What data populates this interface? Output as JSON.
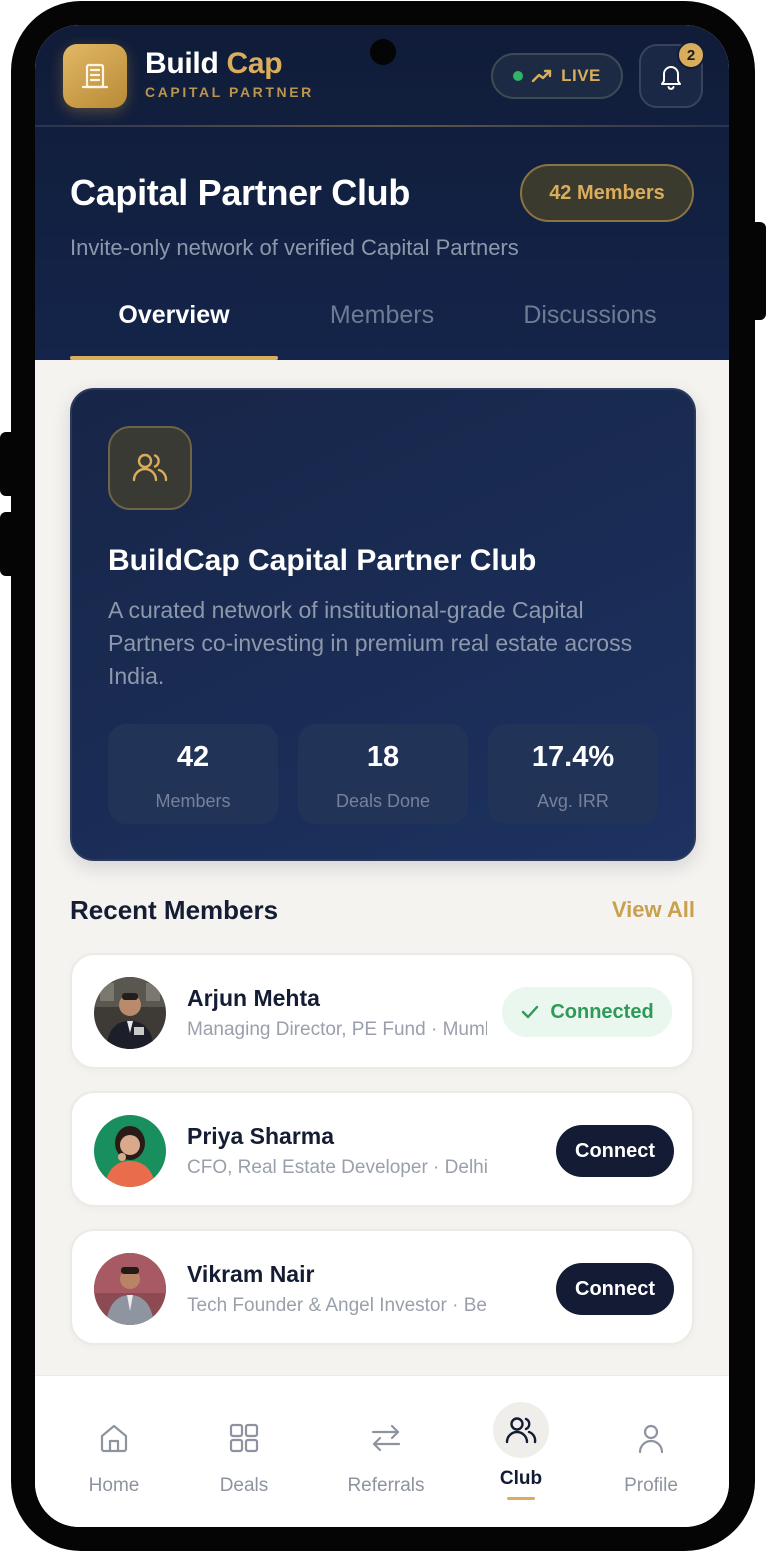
{
  "brand": {
    "name_primary": "Build",
    "name_accent": "Cap",
    "subtitle": "CAPITAL PARTNER",
    "accent_color": "#d9ad5b",
    "navy_color": "#101c38"
  },
  "status": {
    "live_label": "LIVE",
    "live_icon": "trending-up-icon",
    "notification_count": "2"
  },
  "club": {
    "title": "Capital Partner Club",
    "members_badge": "42 Members",
    "subtitle": "Invite-only network of verified Capital Partners"
  },
  "tabs": [
    {
      "label": "Overview",
      "active": true
    },
    {
      "label": "Members",
      "active": false
    },
    {
      "label": "Discussions",
      "active": false
    }
  ],
  "hero": {
    "icon": "users-icon",
    "title": "BuildCap Capital Partner Club",
    "description": "A curated network of institutional-grade Capital Partners co-investing in premium real estate across India.",
    "stats": [
      {
        "value": "42",
        "label": "Members"
      },
      {
        "value": "18",
        "label": "Deals Done"
      },
      {
        "value": "17.4%",
        "label": "Avg. IRR"
      }
    ]
  },
  "recent_members": {
    "title": "Recent Members",
    "view_all": "View All",
    "items": [
      {
        "name": "Arjun Mehta",
        "role": "Managing Director, PE Fund · Mumbai",
        "status": "Connected"
      },
      {
        "name": "Priya Sharma",
        "role": "CFO, Real Estate Developer · Delhi",
        "action": "Connect"
      },
      {
        "name": "Vikram Nair",
        "role": "Tech Founder & Angel Investor · Bengaluru",
        "action": "Connect"
      }
    ]
  },
  "bottom_nav": [
    {
      "label": "Home",
      "icon": "home-icon"
    },
    {
      "label": "Deals",
      "icon": "grid-icon"
    },
    {
      "label": "Referrals",
      "icon": "arrows-exchange-icon"
    },
    {
      "label": "Club",
      "icon": "users-icon",
      "active": true
    },
    {
      "label": "Profile",
      "icon": "user-icon"
    }
  ]
}
